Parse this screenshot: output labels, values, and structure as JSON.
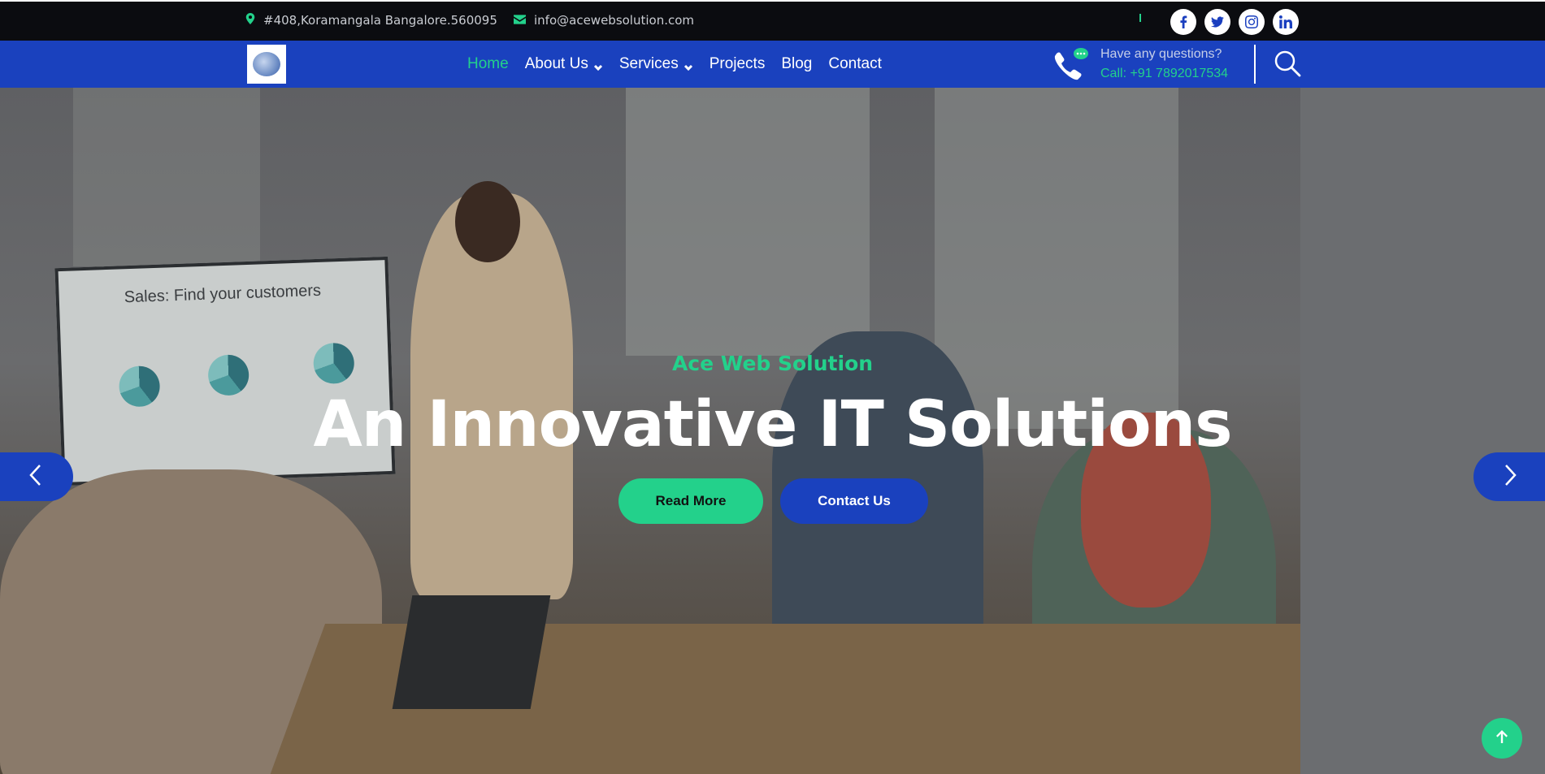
{
  "topbar": {
    "address": "#408,Koramangala Bangalore.560095",
    "email": "info@acewebsolution.com",
    "socials": [
      "facebook-icon",
      "twitter-icon",
      "instagram-icon",
      "linkedin-icon"
    ]
  },
  "nav": {
    "items": [
      {
        "label": "Home",
        "active": true
      },
      {
        "label": "About Us",
        "dropdown": true
      },
      {
        "label": "Services",
        "dropdown": true
      },
      {
        "label": "Projects"
      },
      {
        "label": "Blog"
      },
      {
        "label": "Contact"
      }
    ],
    "question": "Have any questions?",
    "call": "Call: +91 7892017534"
  },
  "hero": {
    "board_title": "Sales: Find your customers",
    "tagline": "Ace Web Solution",
    "headline": "An Innovative IT Solutions",
    "read_more": "Read More",
    "contact_us": "Contact Us"
  },
  "colors": {
    "brand_blue": "#1a41be",
    "accent_green": "#23d18b",
    "topbar_bg": "#0b0c10"
  }
}
